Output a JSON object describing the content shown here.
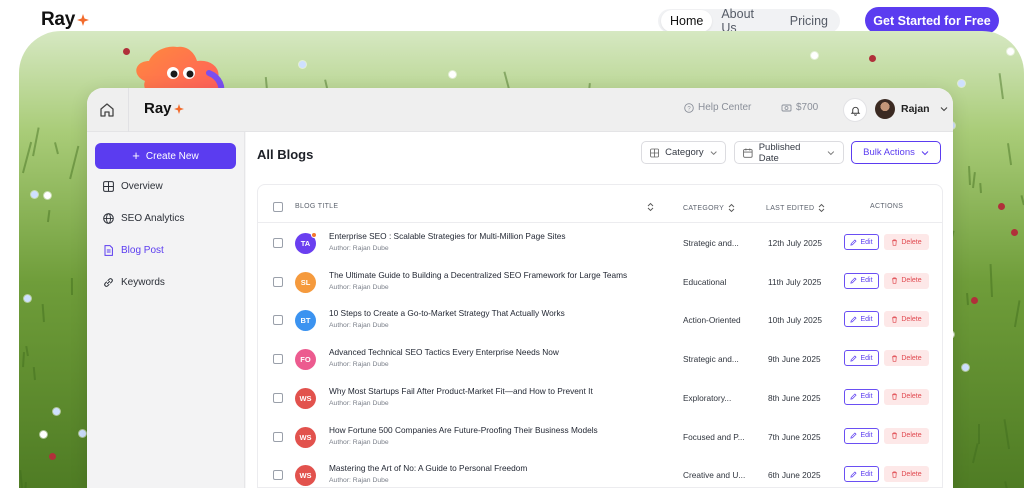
{
  "site": {
    "logo": "Ray",
    "nav": [
      {
        "label": "Home",
        "active": true
      },
      {
        "label": "About Us",
        "active": false
      },
      {
        "label": "Pricing",
        "active": false
      }
    ],
    "cta": "Get Started for Free"
  },
  "app": {
    "logo": "Ray",
    "help_label": "Help Center",
    "credits": "$700",
    "user_name": "Rajan"
  },
  "sidebar": {
    "create_label": "Create New",
    "items": [
      {
        "label": "Overview",
        "icon": "grid-icon",
        "active": false
      },
      {
        "label": "SEO Analytics",
        "icon": "globe-icon",
        "active": false
      },
      {
        "label": "Blog Post",
        "icon": "document-icon",
        "active": true
      },
      {
        "label": "Keywords",
        "icon": "link-icon",
        "active": false
      }
    ]
  },
  "main": {
    "title": "All Blogs",
    "filters": {
      "category": "Category",
      "published": "Published Date",
      "bulk": "Bulk Actions"
    },
    "columns": {
      "title": "BLOG TITLE",
      "category": "CATEGORY",
      "last_edited": "LAST EDITED",
      "actions": "ACTIONS"
    },
    "edit_label": "Edit",
    "delete_label": "Delete",
    "rows": [
      {
        "initials": "TA",
        "color": "#6a3ff0",
        "badge": true,
        "title": "Enterprise SEO : Scalable Strategies for Multi-Million Page Sites",
        "author": "Author: Rajan Dube",
        "category": "Strategic and...",
        "date": "12th July 2025"
      },
      {
        "initials": "SL",
        "color": "#f59a3d",
        "badge": false,
        "title": "The Ultimate Guide to Building a Decentralized SEO Framework for Large Teams",
        "author": "Author: Rajan Dube",
        "category": "Educational",
        "date": "11th July 2025"
      },
      {
        "initials": "BT",
        "color": "#3b93f0",
        "badge": false,
        "title": "10 Steps to Create a Go-to-Market Strategy That Actually Works",
        "author": "Author: Rajan Dube",
        "category": "Action-Oriented",
        "date": "10th July 2025"
      },
      {
        "initials": "FO",
        "color": "#ec5b8f",
        "badge": false,
        "title": "Advanced Technical SEO Tactics Every Enterprise Needs Now",
        "author": "Author: Rajan Dube",
        "category": "Strategic and...",
        "date": "9th June 2025"
      },
      {
        "initials": "WS",
        "color": "#e2524d",
        "badge": false,
        "title": "Why Most Startups Fail After Product-Market Fit—and How to Prevent It",
        "author": "Author: Rajan Dube",
        "category": "Exploratory...",
        "date": "8th June 2025"
      },
      {
        "initials": "WS",
        "color": "#e2524d",
        "badge": false,
        "title": "How Fortune 500 Companies Are Future-Proofing Their Business Models",
        "author": "Author: Rajan Dube",
        "category": "Focused and P...",
        "date": "7th June 2025"
      },
      {
        "initials": "WS",
        "color": "#e2524d",
        "badge": false,
        "title": "Mastering the Art of No: A Guide to Personal Freedom",
        "author": "Author: Rajan Dube",
        "category": "Creative and U...",
        "date": "6th June 2025"
      }
    ]
  },
  "colors": {
    "accent": "#5b3cf0",
    "delete_bg": "#fde8e8",
    "delete_text": "#e0484f"
  }
}
